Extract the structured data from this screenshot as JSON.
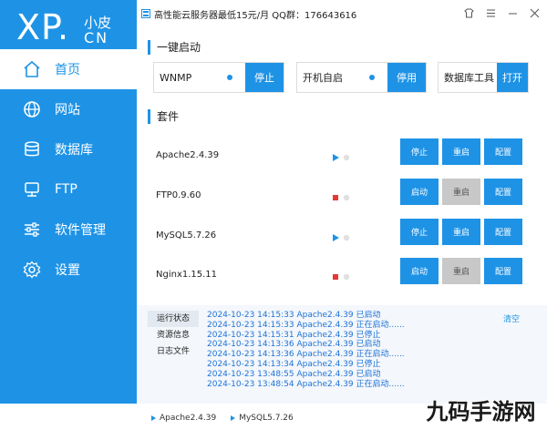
{
  "sidebar": {
    "logo": {
      "main": "XP.",
      "sub": "小皮",
      "cn": "CN"
    },
    "items": [
      {
        "label": "首页",
        "icon": "home-icon",
        "active": true
      },
      {
        "label": "网站",
        "icon": "globe-icon",
        "active": false
      },
      {
        "label": "数据库",
        "icon": "database-icon",
        "active": false
      },
      {
        "label": "FTP",
        "icon": "server-icon",
        "active": false
      },
      {
        "label": "软件管理",
        "icon": "sliders-icon",
        "active": false
      },
      {
        "label": "设置",
        "icon": "gear-icon",
        "active": false
      }
    ]
  },
  "topbar": {
    "ad": "高性能云服务器最低15元/月  QQ群：176643616",
    "icons": [
      "skin-icon",
      "menu-icon",
      "minimize-icon",
      "close-icon"
    ]
  },
  "quick_start": {
    "title": "一键启动",
    "items": [
      {
        "label": "WNMP",
        "button": "停止",
        "has_dot": true
      },
      {
        "label": "开机自启",
        "button": "停用",
        "has_dot": true
      },
      {
        "label": "数据库工具",
        "button": "打开",
        "has_dot": false
      }
    ]
  },
  "suite": {
    "title": "套件",
    "rows": [
      {
        "name": "Apache2.4.39",
        "running": true,
        "buttons": [
          {
            "label": "停止",
            "enabled": true
          },
          {
            "label": "重启",
            "enabled": true
          },
          {
            "label": "配置",
            "enabled": true
          }
        ]
      },
      {
        "name": "FTP0.9.60",
        "running": false,
        "buttons": [
          {
            "label": "启动",
            "enabled": true
          },
          {
            "label": "重启",
            "enabled": false
          },
          {
            "label": "配置",
            "enabled": true
          }
        ]
      },
      {
        "name": "MySQL5.7.26",
        "running": true,
        "buttons": [
          {
            "label": "停止",
            "enabled": true
          },
          {
            "label": "重启",
            "enabled": true
          },
          {
            "label": "配置",
            "enabled": true
          }
        ]
      },
      {
        "name": "Nginx1.15.11",
        "running": false,
        "buttons": [
          {
            "label": "启动",
            "enabled": true
          },
          {
            "label": "重启",
            "enabled": false
          },
          {
            "label": "配置",
            "enabled": true
          }
        ]
      }
    ]
  },
  "log": {
    "tabs": [
      "运行状态",
      "资源信息",
      "日志文件"
    ],
    "active_tab": 0,
    "clear_label": "清空",
    "lines": [
      "2024-10-23 14:15:33 Apache2.4.39 已启动",
      "2024-10-23 14:15:33 Apache2.4.39 正在启动......",
      "2024-10-23 14:15:31 Apache2.4.39 已停止",
      "2024-10-23 14:13:36 Apache2.4.39 已启动",
      "2024-10-23 14:13:36 Apache2.4.39 正在启动......",
      "2024-10-23 14:13:34 Apache2.4.39 已停止",
      "2024-10-23 13:48:55 Apache2.4.39 已启动",
      "2024-10-23 13:48:54 Apache2.4.39 正在启动......"
    ]
  },
  "statusbar": {
    "items": [
      "Apache2.4.39",
      "MySQL5.7.26"
    ]
  },
  "watermark": {
    "text": "九码手游网"
  },
  "colors": {
    "accent": "#1e93e6",
    "running": "#1e93e6",
    "stopped": "#e53935",
    "disabled": "#c8c8c8"
  }
}
